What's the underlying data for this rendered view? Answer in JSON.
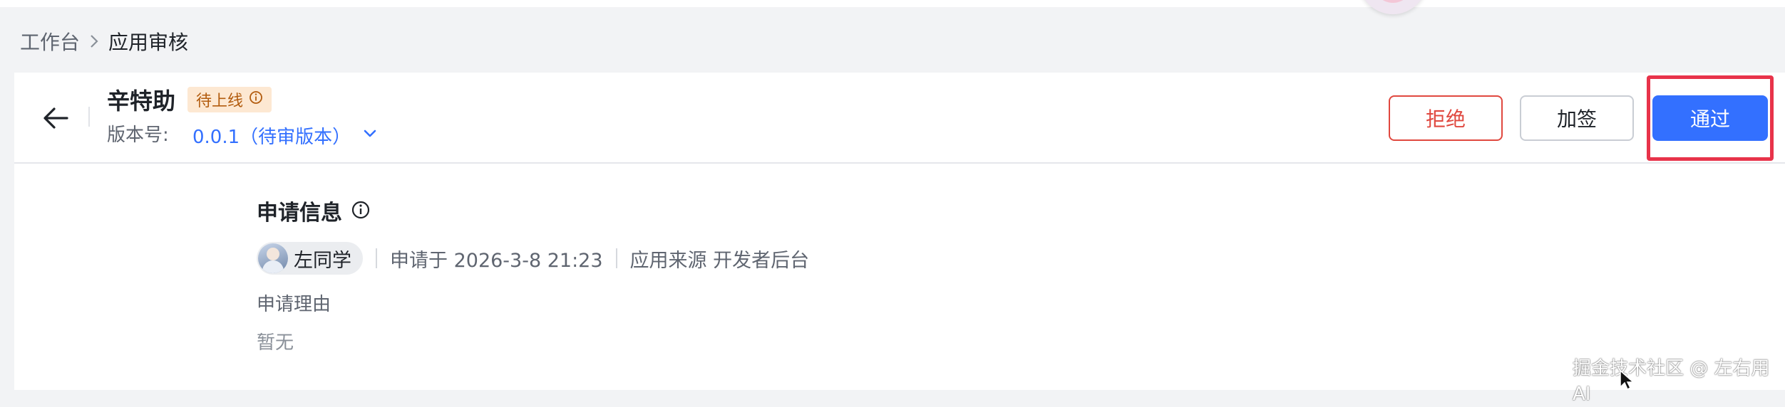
{
  "breadcrumb": {
    "root": "工作台",
    "current": "应用审核"
  },
  "app": {
    "name": "辛特助",
    "status": "待上线",
    "version_label": "版本号:",
    "version_value": "0.0.1（待审版本）"
  },
  "actions": {
    "reject": "拒绝",
    "add_sign": "加签",
    "approve": "通过"
  },
  "application_info": {
    "title": "申请信息",
    "applicant": "左同学",
    "applied_at": "申请于 2026-3-8 21:23",
    "source": "应用来源 开发者后台",
    "reason_label": "申请理由",
    "reason_value": "暂无"
  },
  "watermark": "掘金技术社区 @ 左右用AI",
  "colors": {
    "primary": "#3370ff",
    "danger": "#e0483f",
    "highlight": "#e8334a",
    "badge_bg": "#fde8d2",
    "badge_text": "#b25b0d"
  },
  "icons": {
    "back": "arrow-left-icon",
    "breadcrumb_sep": "chevron-right-icon",
    "status_info": "info-icon",
    "version_dropdown": "chevron-down-icon",
    "section_info": "info-icon"
  }
}
